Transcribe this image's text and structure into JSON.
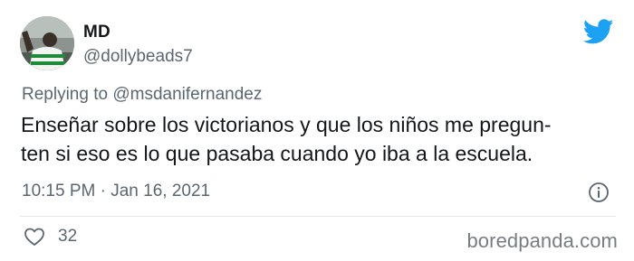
{
  "user": {
    "display_name": "MD",
    "handle": "@dollybeads7"
  },
  "reply": {
    "text": "Replying to @msdanifernandez"
  },
  "tweet": {
    "line1": "Enseñar sobre los victorianos y que los niños me pregun-",
    "line2": "ten si eso es lo que pasaba cuando yo iba a la escuela."
  },
  "meta": {
    "timestamp": "10:15 PM · Jan 16, 2021"
  },
  "actions": {
    "like_count": "32"
  },
  "watermark": {
    "text": "boredpanda.com"
  },
  "icons": {
    "brand": "twitter-bird-icon",
    "info": "info-icon",
    "like": "heart-icon"
  },
  "colors": {
    "twitter_blue": "#1da1f2",
    "text_primary": "#14171a",
    "text_secondary": "#5b6770",
    "divider": "#e1e8ed",
    "watermark": "#777d82"
  }
}
